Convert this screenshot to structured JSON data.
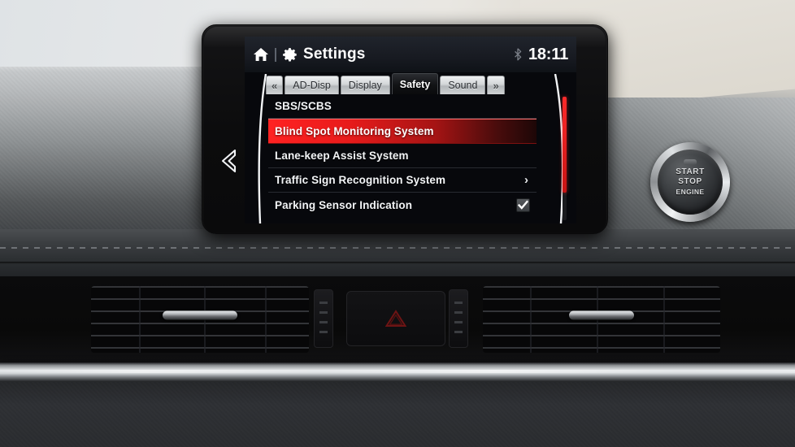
{
  "device": {
    "name": "Mazda MZD Connect infotainment display",
    "screen_glow": "#07080c"
  },
  "status_bar": {
    "home_icon": "home-icon",
    "gear_icon": "gear-icon",
    "title": "Settings",
    "bluetooth_icon": "bluetooth-icon",
    "time": "18:11"
  },
  "tabs": {
    "prev_label": "«",
    "next_label": "»",
    "items": [
      {
        "label": "AD-Disp",
        "active": false
      },
      {
        "label": "Display",
        "active": false
      },
      {
        "label": "Safety",
        "active": true
      },
      {
        "label": "Sound",
        "active": false
      }
    ]
  },
  "menu": {
    "items": [
      {
        "label": "SBS/SCBS",
        "selected": false,
        "control": "none"
      },
      {
        "label": "Blind Spot Monitoring System",
        "selected": true,
        "control": "none"
      },
      {
        "label": "Lane-keep Assist System",
        "selected": false,
        "control": "none"
      },
      {
        "label": "Traffic Sign Recognition System",
        "selected": false,
        "control": "chevron",
        "chevron": "›"
      },
      {
        "label": "Parking Sensor Indication",
        "selected": false,
        "control": "checkbox",
        "checked": true
      }
    ]
  },
  "scrollbar": {
    "name": "vertical-scrollbar",
    "color": "#ff2a2a",
    "thumb_position_percent": 0
  },
  "bezel": {
    "back_arrow_icon": "back-arrow-icon"
  },
  "start_button": {
    "line1": "START",
    "line2": "STOP",
    "line3": "ENGINE"
  },
  "console": {
    "hazard_button": "hazard-warning-button",
    "left_vent": "air-vent-left",
    "right_vent": "air-vent-right",
    "left_switch": "console-switch-left",
    "right_switch": "console-switch-right"
  },
  "colors": {
    "accent_red": "#ff2222",
    "screen_bg": "#07080c",
    "status_bg": "#171a21",
    "text": "#f2f4f6",
    "tab_inactive": "#d2d5d7",
    "tab_active": "#121315"
  }
}
